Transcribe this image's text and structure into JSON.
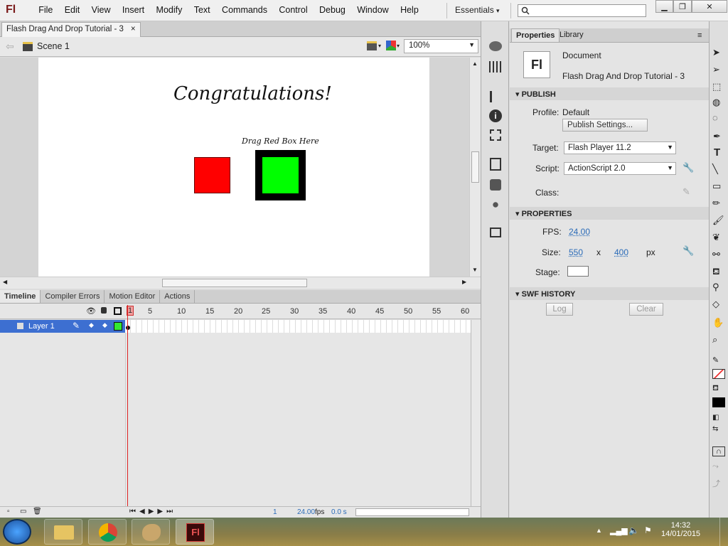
{
  "app": {
    "logo": "Fl"
  },
  "menu": [
    "File",
    "Edit",
    "View",
    "Insert",
    "Modify",
    "Text",
    "Commands",
    "Control",
    "Debug",
    "Window",
    "Help"
  ],
  "workspace": "Essentials",
  "document_tab": {
    "title": "Flash Drag And Drop Tutorial - 3",
    "close": "×"
  },
  "editbar": {
    "scene": "Scene 1",
    "zoom": "100%"
  },
  "stage": {
    "heading": "Congratulations!",
    "drop_label": "Drag Red Box Here"
  },
  "timeline": {
    "tabs": [
      "Timeline",
      "Compiler Errors",
      "Motion Editor",
      "Actions"
    ],
    "ruler": [
      "1",
      "5",
      "10",
      "15",
      "20",
      "25",
      "30",
      "35",
      "40",
      "45",
      "50",
      "55",
      "60"
    ],
    "layer": "Layer 1",
    "status": {
      "frame": "1",
      "fps": "24.00",
      "fps_unit": "fps",
      "time": "0.0 s"
    }
  },
  "properties": {
    "tabs": {
      "properties": "Properties",
      "library": "Library"
    },
    "doc_icon": "Fl",
    "doc_type": "Document",
    "doc_name": "Flash Drag And Drop Tutorial - 3",
    "publish": {
      "header": "PUBLISH",
      "profile_label": "Profile:",
      "profile": "Default",
      "publish_settings": "Publish Settings...",
      "target_label": "Target:",
      "target": "Flash Player 11.2",
      "script_label": "Script:",
      "script": "ActionScript 2.0",
      "class_label": "Class:"
    },
    "props": {
      "header": "PROPERTIES",
      "fps_label": "FPS:",
      "fps": "24.00",
      "size_label": "Size:",
      "width": "550",
      "x": "x",
      "height": "400",
      "unit": "px",
      "stage_label": "Stage:"
    },
    "swf": {
      "header": "SWF HISTORY",
      "log": "Log",
      "clear": "Clear"
    }
  },
  "taskbar": {
    "time": "14:32",
    "date": "14/01/2015"
  },
  "colors": {
    "red_box": "#ff0000",
    "green_box": "#00ff00",
    "layer_highlight": "#3d6fd1"
  }
}
